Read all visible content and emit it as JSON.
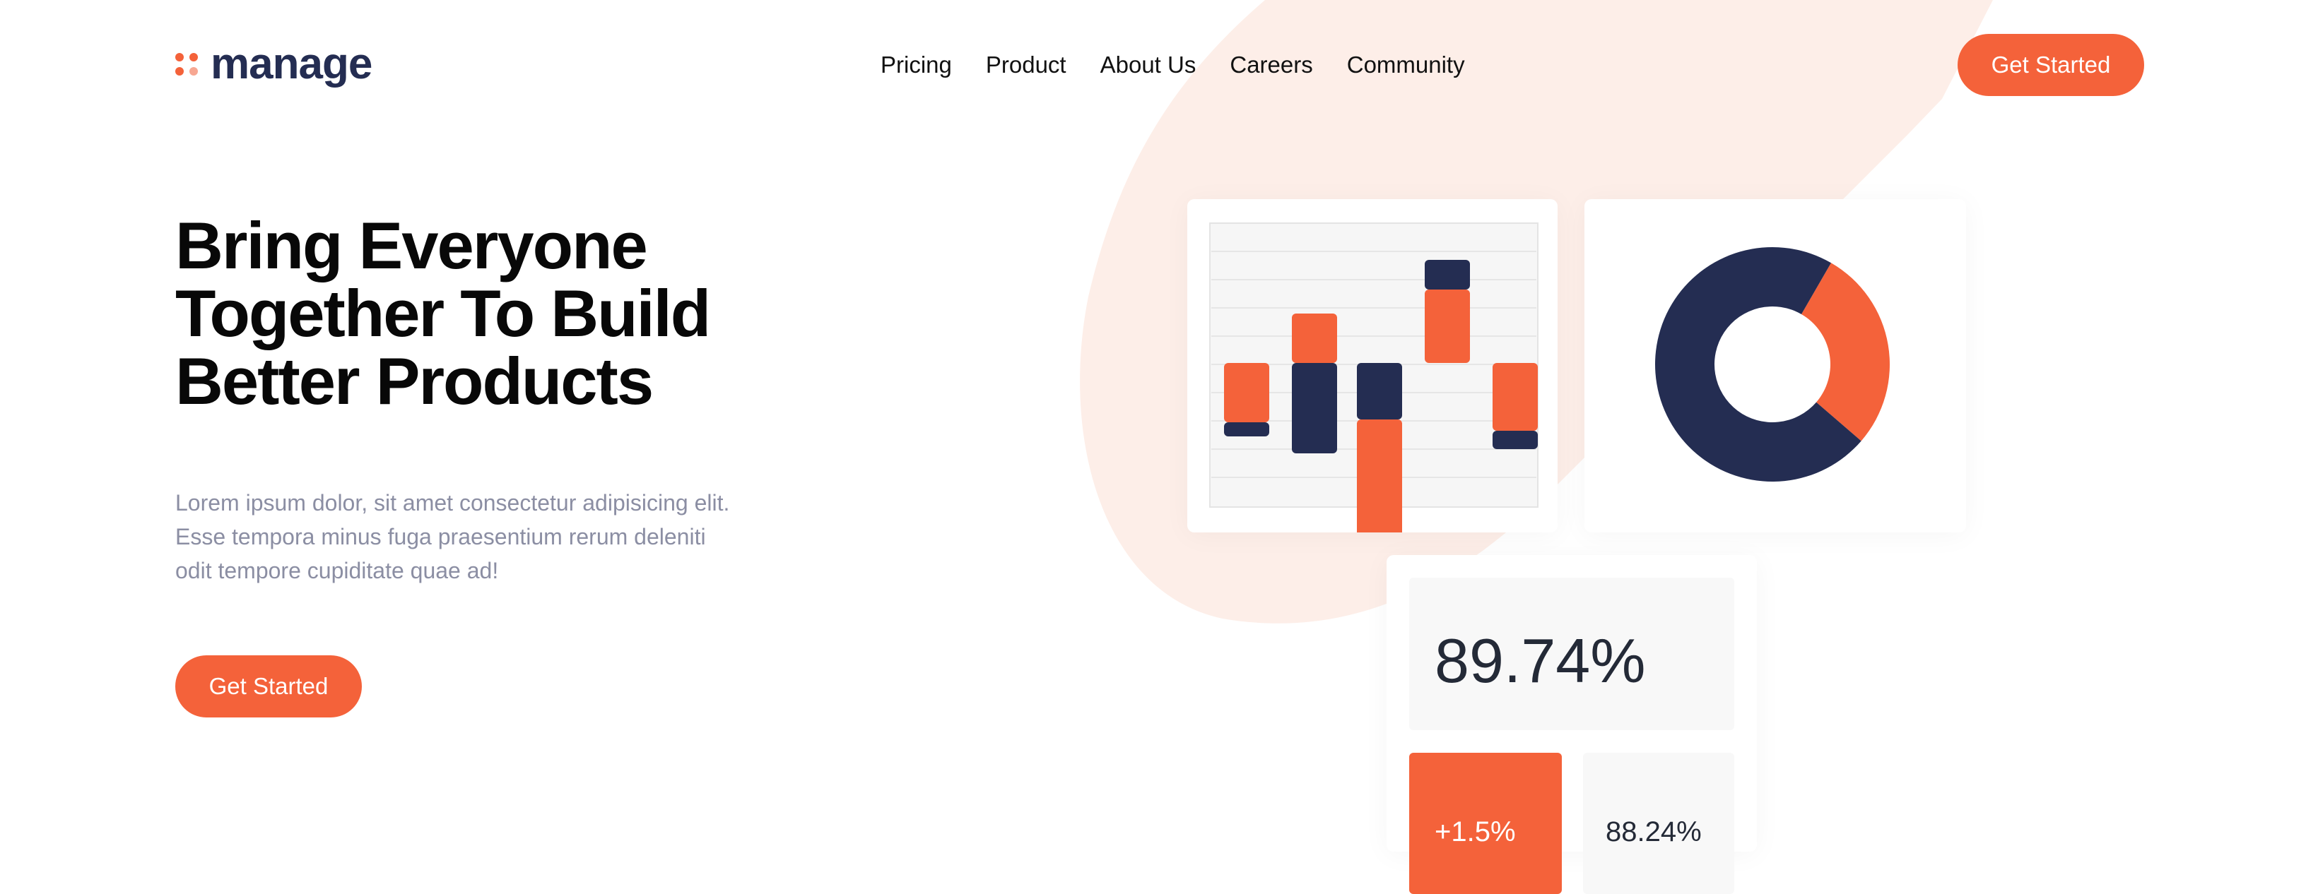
{
  "brand": {
    "name": "manage",
    "accent_color": "#f4623a",
    "dark_color": "#242d52"
  },
  "nav": {
    "items": [
      {
        "label": "Pricing"
      },
      {
        "label": "Product"
      },
      {
        "label": "About Us"
      },
      {
        "label": "Careers"
      },
      {
        "label": "Community"
      }
    ]
  },
  "header": {
    "cta_label": "Get Started"
  },
  "hero": {
    "title": "Bring Everyone Together To Build Better Products",
    "description": "Lorem ipsum dolor, sit amet consectetur adipisicing elit. Esse tempora minus fuga praesentium rerum deleniti odit tempore cupiditate quae ad!",
    "cta_label": "Get Started"
  },
  "stats": {
    "main_value": "89.74%",
    "change_value": "+1.5%",
    "secondary_value": "88.24%"
  },
  "chart_data": [
    {
      "type": "bar",
      "series": [
        {
          "name": "",
          "values": [
            1,
            1,
            1,
            1,
            1
          ],
          "color": "#f4623a"
        },
        {
          "name": "",
          "values": [
            -1,
            1,
            1,
            1,
            -1
          ],
          "color": "#242d52"
        }
      ]
    },
    {
      "type": "pie",
      "values": [
        28,
        72
      ],
      "colors": [
        "#f4623a",
        "#242d52"
      ]
    }
  ]
}
